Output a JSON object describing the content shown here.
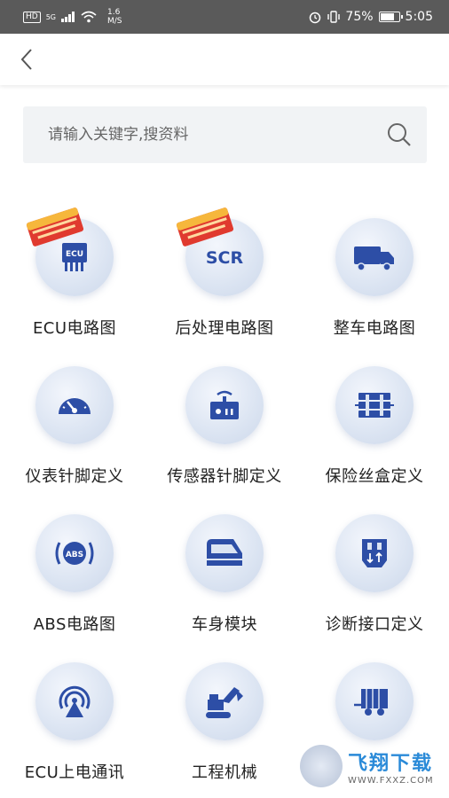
{
  "status_bar": {
    "hd": "HD",
    "network": "5G",
    "speed_value": "1.6",
    "speed_unit": "M/S",
    "battery_percent": "75%",
    "battery_level": 0.75,
    "time": "5:05"
  },
  "search": {
    "placeholder": "请输入关键字,搜资料"
  },
  "grid": {
    "items": [
      {
        "label": "ECU电路图",
        "icon": "ecu-chip-icon",
        "badge": "1000+ 一册在手"
      },
      {
        "label": "后处理电路图",
        "icon": "scr-icon",
        "badge": "1000+ 一册在手"
      },
      {
        "label": "整车电路图",
        "icon": "truck-icon"
      },
      {
        "label": "仪表针脚定义",
        "icon": "gauge-icon"
      },
      {
        "label": "传感器针脚定义",
        "icon": "sensor-icon"
      },
      {
        "label": "保险丝盒定义",
        "icon": "fuse-box-icon"
      },
      {
        "label": "ABS电路图",
        "icon": "abs-icon"
      },
      {
        "label": "车身模块",
        "icon": "car-body-icon"
      },
      {
        "label": "诊断接口定义",
        "icon": "diagnostic-port-icon"
      },
      {
        "label": "ECU上电通讯",
        "icon": "signal-icon"
      },
      {
        "label": "工程机械",
        "icon": "excavator-icon"
      },
      {
        "label": "",
        "icon": "trailer-icon"
      }
    ]
  },
  "watermark": {
    "title": "飞翔下载",
    "url": "WWW.FXXZ.COM"
  },
  "colors": {
    "icon_blue": "#2d4ea6",
    "status_bar_bg": "#5a5a5a",
    "search_bg": "#f1f3f5"
  }
}
